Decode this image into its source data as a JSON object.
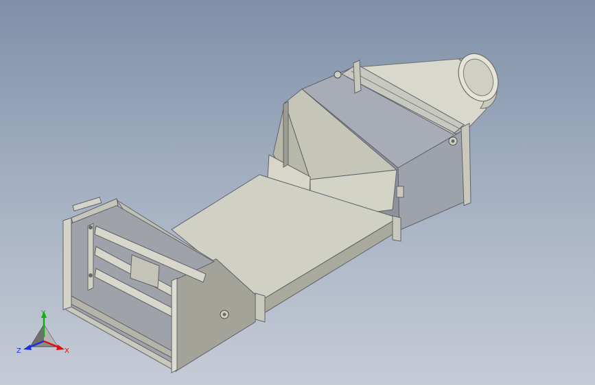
{
  "triad": {
    "x_label": "X",
    "y_label": "Y",
    "z_label": "Z"
  },
  "colors": {
    "background_top": "#7f90a8",
    "background_bottom": "#c6cbd6",
    "metal_light": "#d9d9cf",
    "metal_mid": "#b9b9ad",
    "metal_dark": "#8f8f86",
    "duct_side": "#9a9ea8",
    "axis_x": "#e01010",
    "axis_y": "#12b012",
    "axis_z": "#1b2fe0"
  }
}
